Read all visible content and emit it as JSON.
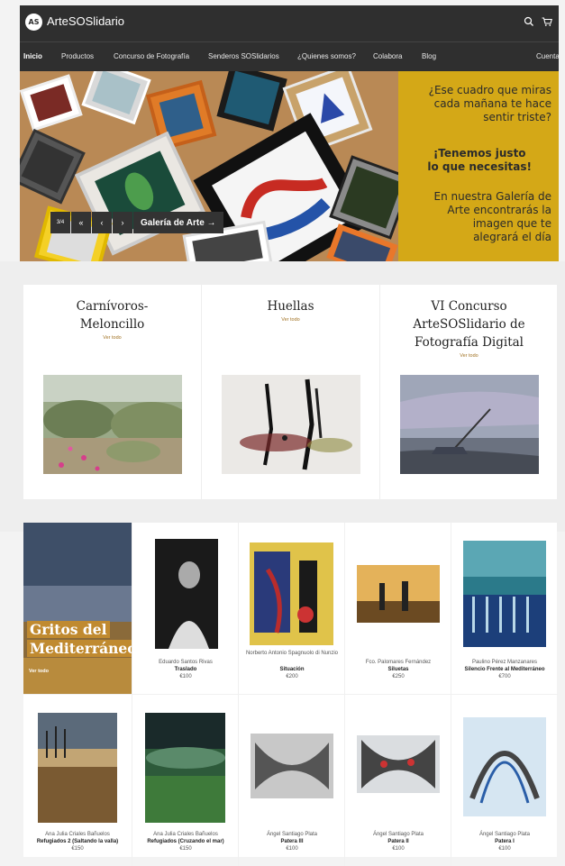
{
  "header": {
    "logo_text": "AS",
    "brand": "ArteSOSlidario",
    "icons": [
      "search-icon",
      "cart-icon"
    ]
  },
  "nav": {
    "items": [
      "Inicio",
      "Productos",
      "Concurso de Fotografía",
      "Senderos SOSlidarios",
      "¿Quienes somos?",
      "Colabora",
      "Blog"
    ],
    "active": "Inicio",
    "account": "Cuenta"
  },
  "hero": {
    "lines_1": [
      "¿Ese cuadro que miras",
      "cada mañana te hace",
      "sentir triste?"
    ],
    "lines_2": [
      "¡Tenemos justo",
      "lo que necesitas!"
    ],
    "lines_3": [
      "En nuestra Galería de",
      "Arte encontrarás la",
      "imagen que te",
      "alegrará el día"
    ],
    "counter": "3/4",
    "first_label": "«",
    "prev_label": "‹",
    "next_label": "›",
    "gallery_button": "Galería de Arte →",
    "colors": {
      "yellow": "#d4a817",
      "wood": "#b88a58"
    }
  },
  "collections": [
    {
      "title": "Carnívoros-Meloncillo",
      "link": "Ver todo"
    },
    {
      "title": "Huellas",
      "link": "Ver todo"
    },
    {
      "title": "VI Concurso ArteSOSlidario de Fotografía Digital",
      "link": "Ver todo"
    }
  ],
  "featured": {
    "title_line1": "Gritos del",
    "title_line2": "Mediterráneo",
    "link": "Ver todo"
  },
  "products": [
    {
      "artist": "Eduardo Santos Rivas",
      "title": "Traslado",
      "price": "€100"
    },
    {
      "artist": "Norberto Antonio Spagnuolo di Nunzio",
      "title": "Situación",
      "price": "€200"
    },
    {
      "artist": "Fco. Palomares Fernández",
      "title": "Siluetas",
      "price": "€250"
    },
    {
      "artist": "Paulino Pérez Manzanares",
      "title": "Silencio Frente al Mediterráneo",
      "price": "€700"
    },
    {
      "artist": "Ana Julia Criales Bañuelos",
      "title": "Refugiados 2 (Saltando la valla)",
      "price": "€150"
    },
    {
      "artist": "Ana Julia Criales Bañuelos",
      "title": "Refugiados (Cruzando el mar)",
      "price": "€150"
    },
    {
      "artist": "Ángel Santiago Plata",
      "title": "Patera III",
      "price": "€100"
    },
    {
      "artist": "Ángel Santiago Plata",
      "title": "Patera II",
      "price": "€100"
    },
    {
      "artist": "Ángel Santiago Plata",
      "title": "Patera I",
      "price": "€100"
    }
  ]
}
